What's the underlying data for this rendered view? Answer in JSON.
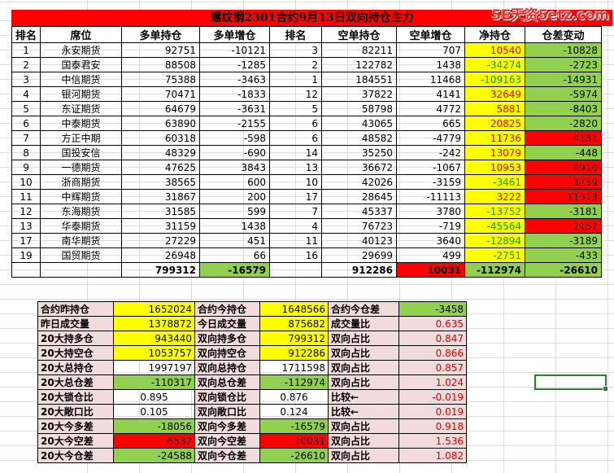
{
  "title": "螺纹钢2301合约9月13日双向持仓主力",
  "watermark": "5E天资5etz.com",
  "headers": [
    "排名",
    "席位",
    "多单持仓",
    "多单增仓",
    "排名",
    "空单持仓",
    "空单增仓",
    "净持仓",
    "仓差变动"
  ],
  "rows": [
    {
      "rank": "1",
      "seat": "永安期货",
      "long": "92751",
      "long_chg": "-10121",
      "srank": "3",
      "short": "82211",
      "short_chg": "707",
      "net": "10540",
      "net_style": "yel-red",
      "diff": "-10828",
      "diff_style": "grn"
    },
    {
      "rank": "2",
      "seat": "国泰君安",
      "long": "88508",
      "long_chg": "-1285",
      "srank": "2",
      "short": "122782",
      "short_chg": "1438",
      "net": "-34274",
      "net_style": "yel-grn",
      "diff": "-2723",
      "diff_style": "grn"
    },
    {
      "rank": "3",
      "seat": "中信期货",
      "long": "75388",
      "long_chg": "-3463",
      "srank": "1",
      "short": "184551",
      "short_chg": "11468",
      "net": "-109163",
      "net_style": "yel-grn",
      "diff": "-14931",
      "diff_style": "grn"
    },
    {
      "rank": "4",
      "seat": "银河期货",
      "long": "70471",
      "long_chg": "-1833",
      "srank": "12",
      "short": "37822",
      "short_chg": "4141",
      "net": "32649",
      "net_style": "yel-red",
      "diff": "-5974",
      "diff_style": "grn"
    },
    {
      "rank": "5",
      "seat": "东证期货",
      "long": "64679",
      "long_chg": "-3631",
      "srank": "5",
      "short": "58798",
      "short_chg": "4772",
      "net": "5881",
      "net_style": "yel-red",
      "diff": "-8403",
      "diff_style": "grn"
    },
    {
      "rank": "6",
      "seat": "中泰期货",
      "long": "63890",
      "long_chg": "-2155",
      "srank": "6",
      "short": "43065",
      "short_chg": "665",
      "net": "20825",
      "net_style": "yel-red",
      "diff": "-2820",
      "diff_style": "grn"
    },
    {
      "rank": "7",
      "seat": "方正中期",
      "long": "60318",
      "long_chg": "-598",
      "srank": "6",
      "short": "48582",
      "short_chg": "-4779",
      "net": "11736",
      "net_style": "yel-red",
      "diff": "4181",
      "diff_style": "red"
    },
    {
      "rank": "8",
      "seat": "国投安信",
      "long": "48329",
      "long_chg": "-690",
      "srank": "14",
      "short": "35250",
      "short_chg": "-242",
      "net": "13079",
      "net_style": "yel-red",
      "diff": "-448",
      "diff_style": "grn"
    },
    {
      "rank": "9",
      "seat": "一德期货",
      "long": "47625",
      "long_chg": "3843",
      "srank": "13",
      "short": "36672",
      "short_chg": "-1067",
      "net": "10953",
      "net_style": "yel-red",
      "diff": "4910",
      "diff_style": "red"
    },
    {
      "rank": "10",
      "seat": "浙商期货",
      "long": "38565",
      "long_chg": "600",
      "srank": "10",
      "short": "42026",
      "short_chg": "-3159",
      "net": "-3461",
      "net_style": "yel-grn",
      "diff": "3759",
      "diff_style": "red"
    },
    {
      "rank": "11",
      "seat": "中辉期货",
      "long": "31867",
      "long_chg": "200",
      "srank": "17",
      "short": "28645",
      "short_chg": "-11113",
      "net": "3222",
      "net_style": "yel-red",
      "diff": "11313",
      "diff_style": "red"
    },
    {
      "rank": "12",
      "seat": "东海期货",
      "long": "31585",
      "long_chg": "599",
      "srank": "7",
      "short": "45337",
      "short_chg": "3780",
      "net": "-13752",
      "net_style": "yel-grn",
      "diff": "-3181",
      "diff_style": "grn"
    },
    {
      "rank": "13",
      "seat": "华泰期货",
      "long": "31159",
      "long_chg": "1438",
      "srank": "4",
      "short": "76723",
      "short_chg": "-719",
      "net": "-45564",
      "net_style": "yel-grn",
      "diff": "2157",
      "diff_style": "red"
    },
    {
      "rank": "17",
      "seat": "南华期货",
      "long": "27229",
      "long_chg": "451",
      "srank": "11",
      "short": "40123",
      "short_chg": "3640",
      "net": "-12894",
      "net_style": "yel-grn",
      "diff": "-3189",
      "diff_style": "grn"
    },
    {
      "rank": "19",
      "seat": "国贸期货",
      "long": "26948",
      "long_chg": "66",
      "srank": "16",
      "short": "29699",
      "short_chg": "499",
      "net": "-2751",
      "net_style": "yel-grn",
      "diff": "-433",
      "diff_style": "grn"
    }
  ],
  "totals": {
    "long": "799312",
    "long_chg": "-16579",
    "short": "912286",
    "short_chg": "10031",
    "net": "-112974",
    "diff": "-26610"
  },
  "summary": [
    {
      "l1": "合约昨持仓",
      "v1": "1652024",
      "v1s": "yel",
      "l2": "合约今持仓",
      "v2": "1648566",
      "v2s": "yel",
      "l3": "合约今仓差",
      "v3": "-3458",
      "v3s": "grn"
    },
    {
      "l1": "昨日成交量",
      "v1": "1378872",
      "v1s": "yel",
      "l2": "今日成交量",
      "v2": "875682",
      "v2s": "yel",
      "l3": "成交量比",
      "v3": "0.635",
      "v3s": "rtx"
    },
    {
      "l1": "20大持多仓",
      "v1": "943440",
      "v1s": "yel",
      "l2": "双向持多仓",
      "v2": "799312",
      "v2s": "yel",
      "l3": "双向占比",
      "v3": "0.847",
      "v3s": "rtx"
    },
    {
      "l1": "20大持空仓",
      "v1": "1053757",
      "v1s": "yel",
      "l2": "双向持空仓",
      "v2": "912286",
      "v2s": "yel",
      "l3": "双向占比",
      "v3": "0.866",
      "v3s": "rtx"
    },
    {
      "l1": "20大总持仓",
      "v1": "1997197",
      "v1s": "",
      "l2": "双向总持仓",
      "v2": "1711598",
      "v2s": "",
      "l3": "双向占比",
      "v3": "0.857",
      "v3s": "rtx"
    },
    {
      "l1": "20大总仓差",
      "v1": "-110317",
      "v1s": "grn",
      "l2": "双向总仓差",
      "v2": "-112974",
      "v2s": "grn",
      "l3": "双向占比",
      "v3": "1.024",
      "v3s": "rtx"
    },
    {
      "l1": "20大锁仓比",
      "v1": "0.895",
      "v1s": "c",
      "l2": "双向锁仓比",
      "v2": "0.876",
      "v2s": "c",
      "l3": "比较←",
      "v3": "-0.019",
      "v3s": "rtx"
    },
    {
      "l1": "20大敞口比",
      "v1": "0.105",
      "v1s": "c",
      "l2": "双向敞口比",
      "v2": "0.124",
      "v2s": "c",
      "l3": "比较←",
      "v3": "0.019",
      "v3s": "rtx"
    },
    {
      "l1": "20大今多差",
      "v1": "-18056",
      "v1s": "grn",
      "l2": "双向今多差",
      "v2": "-16579",
      "v2s": "grn",
      "l3": "双向占比",
      "v3": "0.918",
      "v3s": "rtx"
    },
    {
      "l1": "20大今空差",
      "v1": "6532",
      "v1s": "red",
      "l2": "双向今空差",
      "v2": "10031",
      "v2s": "red",
      "l3": "双向占比",
      "v3": "1.536",
      "v3s": "rtx"
    },
    {
      "l1": "20大今仓差",
      "v1": "-24588",
      "v1s": "grn",
      "l2": "双向今仓差",
      "v2": "-26610",
      "v2s": "grn",
      "l3": "双向占比",
      "v3": "1.082",
      "v3s": "rtx"
    }
  ],
  "colors": {
    "yellow": "#ffff00",
    "red": "#ff0000",
    "green": "#92d050",
    "label_bg": "#f2dcdb"
  }
}
